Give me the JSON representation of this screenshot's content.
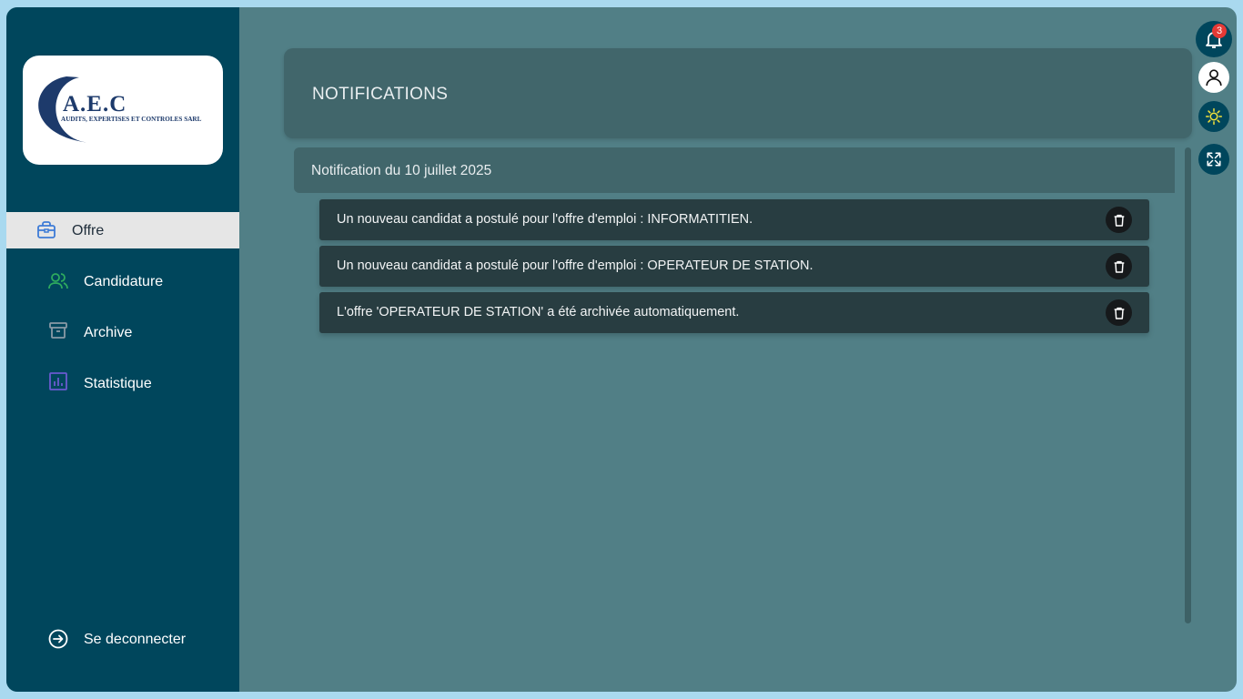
{
  "logo": {
    "title": "A.E.C",
    "subtitle": "AUDITS, EXPERTISES ET CONTROLES SARL"
  },
  "sidebar": {
    "items": [
      {
        "label": "Offre",
        "icon": "briefcase-icon",
        "active": true,
        "color": "#3d7bd6"
      },
      {
        "label": "Candidature",
        "icon": "users-icon",
        "active": false,
        "color": "#2eaa5e"
      },
      {
        "label": "Archive",
        "icon": "archive-icon",
        "active": false,
        "color": "#8a9aa6"
      },
      {
        "label": "Statistique",
        "icon": "bar-chart-icon",
        "active": false,
        "color": "#6a5ad0"
      }
    ],
    "logout": {
      "label": "Se deconnecter",
      "icon": "logout-icon"
    }
  },
  "main": {
    "title": "NOTIFICATIONS",
    "groups": [
      {
        "title": "Notification du 10 juillet 2025",
        "items": [
          {
            "text": "Un nouveau candidat a postulé pour l'offre d'emploi : INFORMATITIEN."
          },
          {
            "text": "Un nouveau candidat a postulé pour l'offre d'emploi : OPERATEUR DE STATION."
          },
          {
            "text": "L'offre 'OPERATEUR DE STATION' a été archivée automatiquement."
          }
        ]
      }
    ]
  },
  "toolbar": {
    "notification_count": "3",
    "buttons": [
      "bell-icon",
      "user-icon",
      "sun-icon",
      "fullscreen-icon"
    ]
  },
  "colors": {
    "sidebar": "#00465c",
    "main": "#517f86",
    "card": "#41666b",
    "notif": "#283d41",
    "badge": "#e53935"
  }
}
